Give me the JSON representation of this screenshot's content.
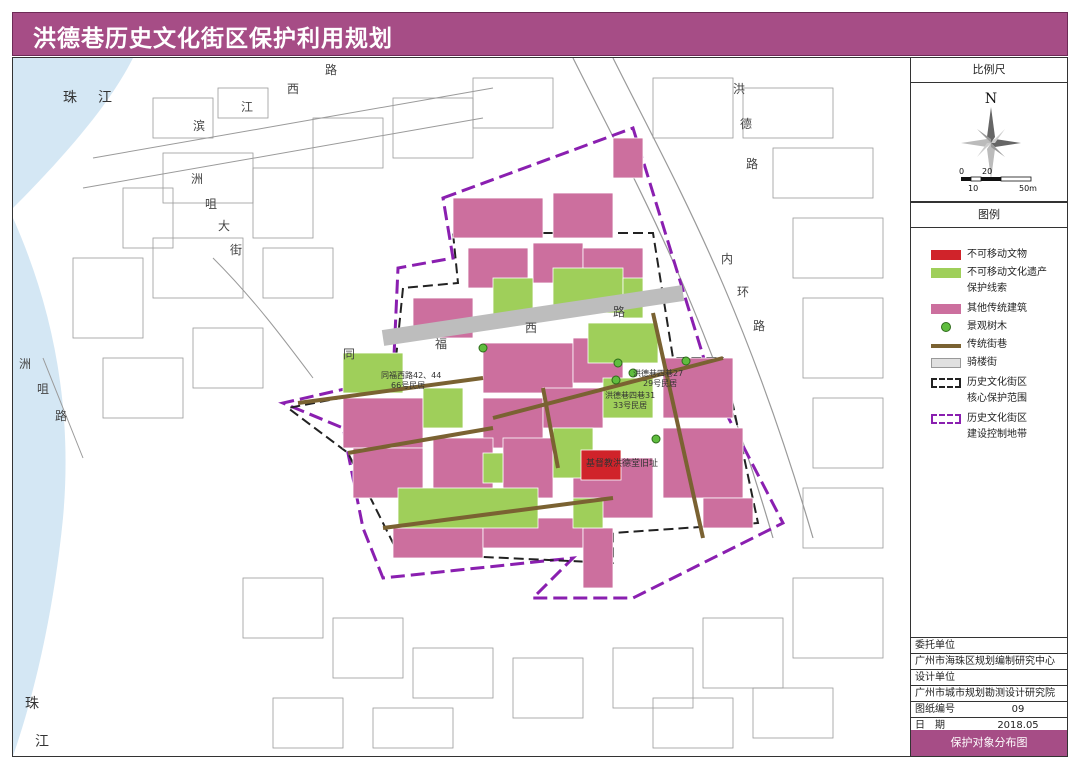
{
  "title": "洪德巷历史文化街区保护利用规划",
  "colors": {
    "theme": "#a64d86",
    "relic": "#d0232a",
    "heritage": "#9fcf5a",
    "traditional": "#cc6f9e",
    "tree": "#5fbd3e",
    "lane": "#7a6232",
    "arcade": "#bdbdbd",
    "core_boundary": "#222222",
    "control_boundary": "#8a1fb0",
    "river": "#d4e7f4"
  },
  "map_labels": {
    "river_top_1": "珠",
    "river_top_2": "江",
    "river_bottom_1": "珠",
    "river_bottom_2": "江",
    "binjiang_chars": [
      "路",
      "西",
      "江",
      "滨"
    ],
    "zhoutou_chars": [
      "洲",
      "咀",
      "大",
      "街"
    ],
    "zhoutou_road_chars": [
      "洲",
      "咀",
      "路"
    ],
    "hongde_chars": [
      "洪",
      "德",
      "路"
    ],
    "neihuan_chars": [
      "内",
      "环",
      "路"
    ],
    "tongfu_chars": [
      "同",
      "福",
      "西",
      "路"
    ],
    "site_a_1": "同福西路42、44",
    "site_a_2": "66号民居",
    "site_b_1": "洪德巷四巷27",
    "site_b_2": "29号民居",
    "site_c_1": "洪德巷四巷31",
    "site_c_2": "33号民居",
    "church": "基督教洪德堂旧址"
  },
  "scale": {
    "header": "比例尺",
    "north": "N",
    "ticks_top": [
      "0",
      "20"
    ],
    "ticks_bottom": [
      "10",
      "50m"
    ]
  },
  "legend": {
    "header": "图例",
    "items": [
      {
        "label": "不可移动文物",
        "icon": "red-square"
      },
      {
        "label": "不可移动文化遗产",
        "icon": "green-square"
      },
      {
        "label": "保护线索",
        "icon": ""
      },
      {
        "label": "其他传统建筑",
        "icon": "pink-square"
      },
      {
        "label": "景观树木",
        "icon": "green-dot"
      },
      {
        "label": "传统街巷",
        "icon": "brown-line"
      },
      {
        "label": "骑楼街",
        "icon": "grey-band"
      },
      {
        "label": "历史文化街区",
        "icon": "black-dash-box"
      },
      {
        "label": "核心保护范围",
        "icon": ""
      },
      {
        "label": "历史文化街区",
        "icon": "purple-dash-box"
      },
      {
        "label": "建设控制地带",
        "icon": ""
      }
    ]
  },
  "info": {
    "client_label": "委托单位",
    "client_value": "广州市海珠区规划编制研究中心",
    "designer_label": "设计单位",
    "designer_value": "广州市城市规划勘测设计研究院",
    "drawing_no_label": "图纸编号",
    "drawing_no_value": "09",
    "date_label": "日　期",
    "date_value": "2018.05"
  },
  "footer": "保护对象分布图"
}
